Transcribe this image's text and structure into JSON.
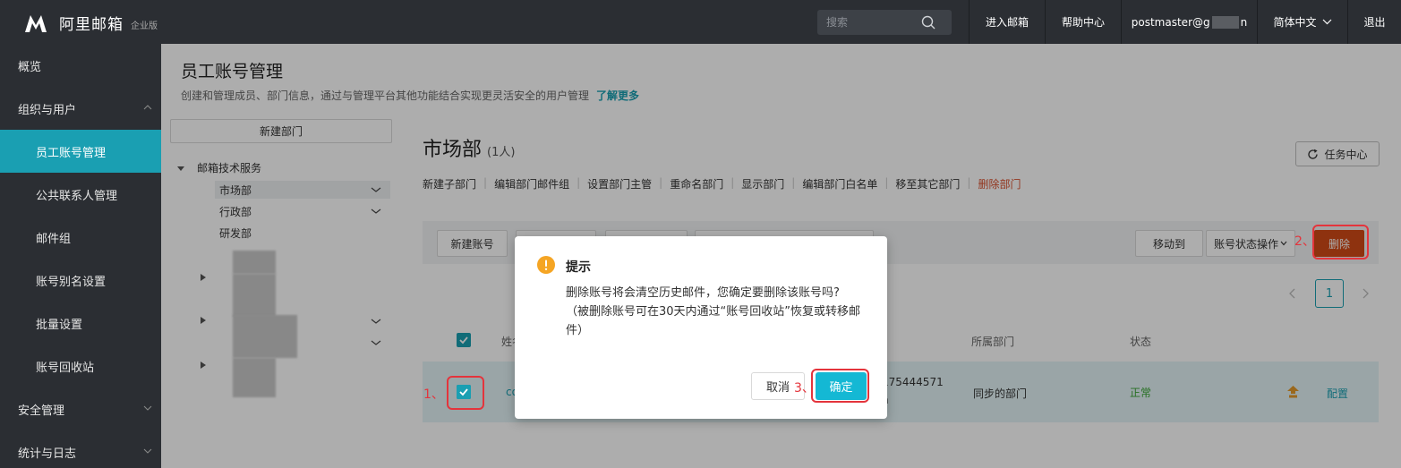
{
  "app": {
    "name": "阿里邮箱",
    "edition": "企业版"
  },
  "topbar": {
    "search_placeholder": "搜索",
    "enter_mail": "进入邮箱",
    "help": "帮助中心",
    "account": "postmaster@g",
    "account_tail": "n",
    "language": "简体中文",
    "logout": "退出"
  },
  "sidebar": {
    "items": [
      {
        "label": "概览"
      },
      {
        "label": "组织与用户"
      },
      {
        "label": "员工账号管理"
      },
      {
        "label": "公共联系人管理"
      },
      {
        "label": "邮件组"
      },
      {
        "label": "账号别名设置"
      },
      {
        "label": "批量设置"
      },
      {
        "label": "账号回收站"
      },
      {
        "label": "安全管理"
      },
      {
        "label": "统计与日志"
      }
    ]
  },
  "header": {
    "title": "员工账号管理",
    "desc": "创建和管理成员、部门信息，通过与管理平台其他功能结合实现更灵活安全的用户管理",
    "learn_more": "了解更多"
  },
  "tree": {
    "new_dept": "新建部门",
    "root": "邮箱技术服务",
    "children": [
      "市场部",
      "行政部",
      "研发部"
    ]
  },
  "dept": {
    "name": "市场部",
    "count": "(1人)",
    "task_center": "任务中心",
    "actions": [
      "新建子部门",
      "编辑部门邮件组",
      "设置部门主管",
      "重命名部门",
      "显示部门",
      "编辑部门白名单",
      "移至其它部门"
    ],
    "delete_dept": "删除部门"
  },
  "toolbar": {
    "new_account": "新建账号",
    "move_to": "移动到",
    "status_ops": "账号状态操作",
    "delete": "删除"
  },
  "pager": {
    "current": "1"
  },
  "table": {
    "headers": {
      "name": "姓名",
      "dept": "所属部门",
      "status": "状态"
    },
    "row": {
      "name": "co",
      "phone": "175444571",
      "phone_tail": "n",
      "dept": "同步的部门",
      "status": "正常",
      "config": "配置"
    }
  },
  "steps": {
    "one": "1、",
    "two": "2、",
    "three": "3、"
  },
  "modal": {
    "title": "提示",
    "line1": "删除账号将会清空历史邮件，您确定要删除该账号吗?",
    "line2": "（被删除账号可在30天内通过“账号回收站”恢复或转移邮件）",
    "cancel": "取消",
    "ok": "确定"
  },
  "colors": {
    "accent": "#1a9fb2",
    "danger": "#d24a17",
    "highlight": "#e4343c"
  }
}
